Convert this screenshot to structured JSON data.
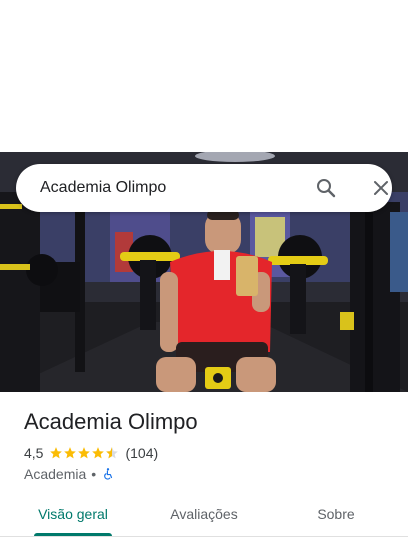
{
  "search": {
    "query": "Academia Olimpo",
    "search_icon": "search-icon",
    "close_icon": "close-icon"
  },
  "place": {
    "name": "Academia Olimpo",
    "rating": "4,5",
    "rating_value": 4.5,
    "review_count": "(104)",
    "category": "Academia",
    "separator": "•",
    "accessibility_icon": "wheelchair-icon"
  },
  "tabs": [
    {
      "label": "Visão geral",
      "active": true
    },
    {
      "label": "Avaliações",
      "active": false
    },
    {
      "label": "Sobre",
      "active": false
    }
  ],
  "colors": {
    "accent": "#00796b",
    "star": "#fbbc04",
    "accessibility": "#1a73e8"
  }
}
